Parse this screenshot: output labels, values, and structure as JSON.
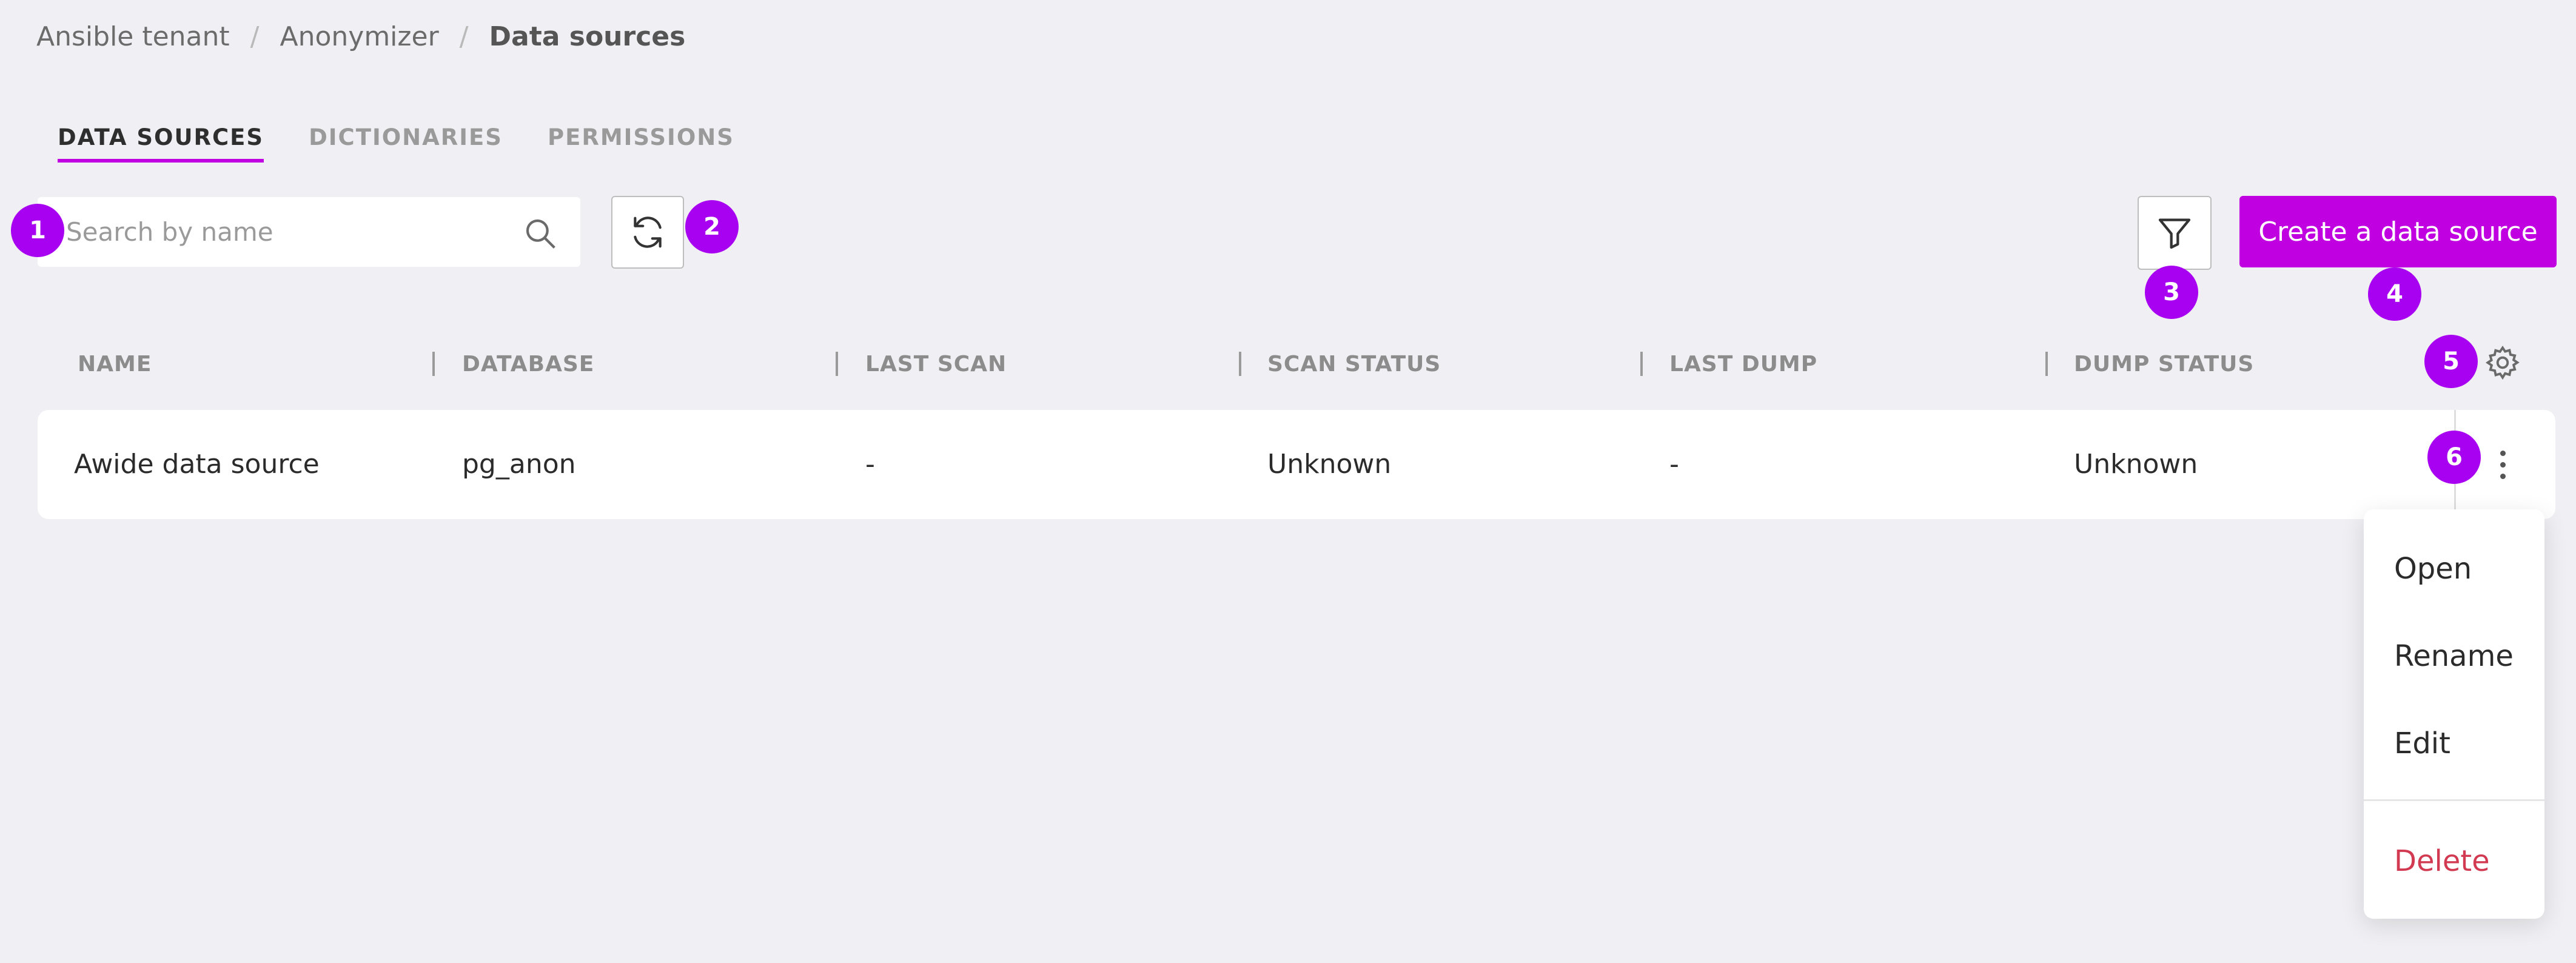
{
  "breadcrumb": {
    "items": [
      "Ansible tenant",
      "Anonymizer",
      "Data sources"
    ],
    "separator": "/"
  },
  "tabs": [
    {
      "label": "DATA SOURCES",
      "active": true
    },
    {
      "label": "DICTIONARIES",
      "active": false
    },
    {
      "label": "PERMISSIONS",
      "active": false
    }
  ],
  "search": {
    "placeholder": "Search by name",
    "value": "",
    "icon": "search-icon"
  },
  "toolbar": {
    "refresh_icon": "refresh-icon",
    "filter_icon": "filter-icon",
    "create_label": "Create a data source"
  },
  "badges": [
    "1",
    "2",
    "3",
    "4",
    "5",
    "6"
  ],
  "table": {
    "columns": [
      "NAME",
      "DATABASE",
      "LAST SCAN",
      "SCAN STATUS",
      "LAST DUMP",
      "DUMP STATUS"
    ],
    "settings_icon": "gear-icon",
    "rows": [
      {
        "name": "Awide data source",
        "database": "pg_anon",
        "last_scan": "-",
        "scan_status": "Unknown",
        "last_dump": "-",
        "dump_status": "Unknown"
      }
    ]
  },
  "row_menu": {
    "items": [
      "Open",
      "Rename",
      "Edit"
    ],
    "danger_item": "Delete"
  },
  "colors": {
    "accent": "#c000e0",
    "badge": "#a800f0",
    "danger": "#d23a52",
    "background": "#f0eff3"
  }
}
